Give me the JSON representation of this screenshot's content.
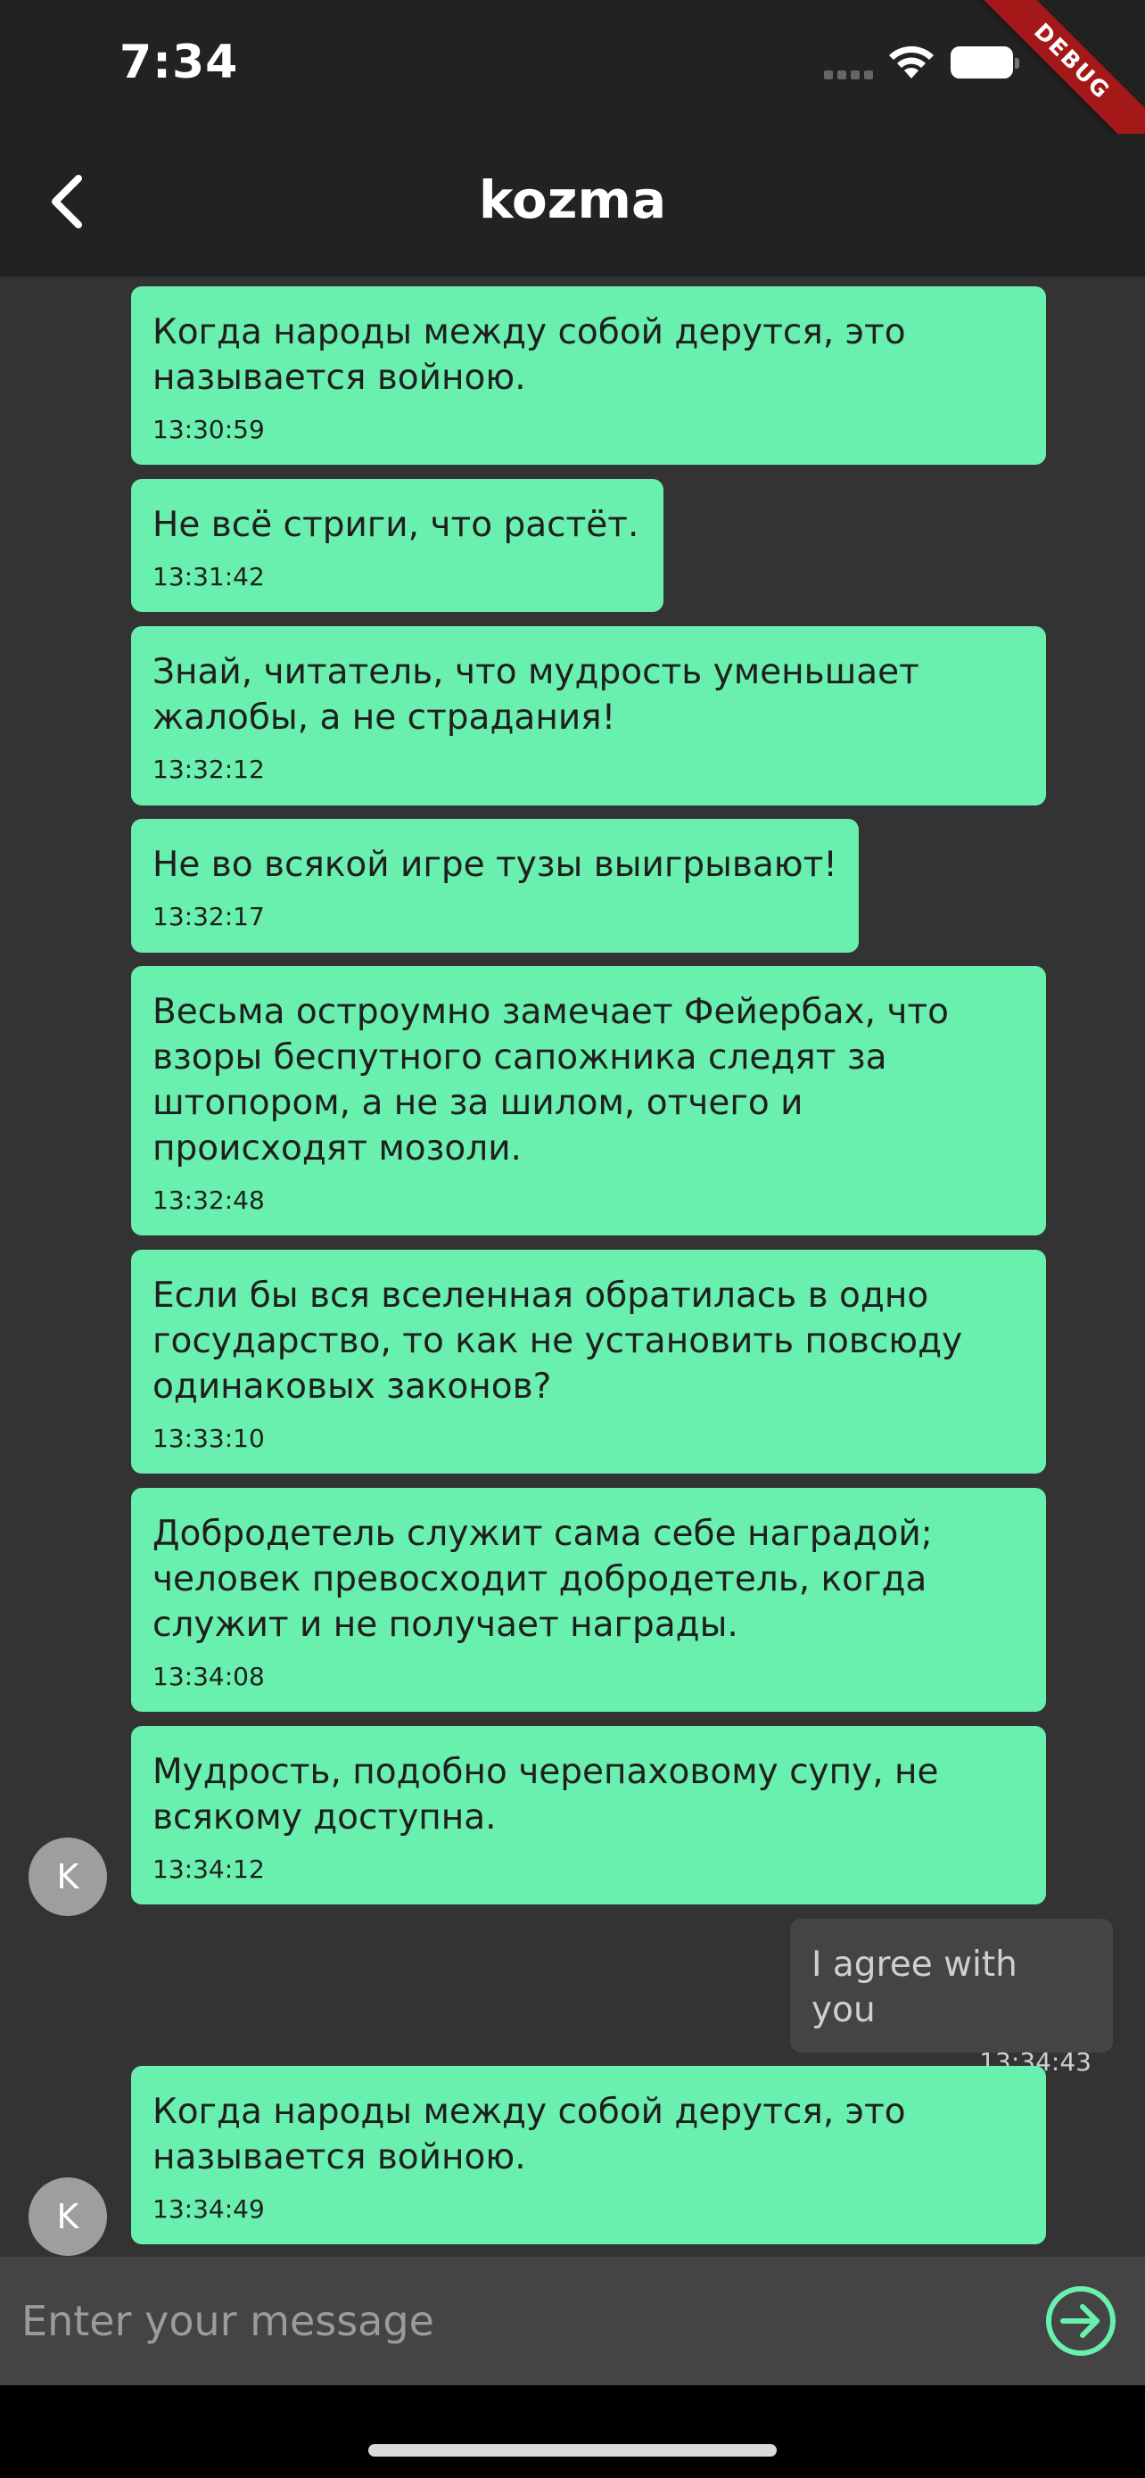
{
  "status_bar": {
    "time": "7:34",
    "debug_label": "DEBUG"
  },
  "app_bar": {
    "title": "kozma",
    "back_icon": "chevron-left-icon"
  },
  "messages": [
    {
      "direction": "in",
      "text": "Когда народы между собой дерутся, это\nназывается войною.",
      "time": "13:30:59"
    },
    {
      "direction": "in",
      "text": "Не всё стриги, что растёт.",
      "time": "13:31:42"
    },
    {
      "direction": "in",
      "text": "Знай, читатель, что мудрость уменьшает\nжалобы, а не страдания!",
      "time": "13:32:12"
    },
    {
      "direction": "in",
      "text": "Не во всякой игре тузы выигрывают!",
      "time": "13:32:17"
    },
    {
      "direction": "in",
      "text": "Весьма остроумно замечает Фейербах, что\nвзоры беспутного сапожника следят за\nштопором, а не за шилом, отчего и\nпроисходят мозоли.",
      "time": "13:32:48"
    },
    {
      "direction": "in",
      "text": "Если бы вся вселенная обратилась в одно\nгосударство, то как не установить повсюду\nодинаковых законов?",
      "time": "13:33:10"
    },
    {
      "direction": "in",
      "text": "Добродетель служит сама себе наградой;\nчеловек превосходит добродетель, когда\nслужит и не получает награды.",
      "time": "13:34:08"
    },
    {
      "direction": "in",
      "text": "Мудрость, подобно черепаховому супу, не\nвсякому доступна.",
      "time": "13:34:12",
      "avatar": "K"
    },
    {
      "direction": "out",
      "text": "I agree with you",
      "time": "13:34:43"
    },
    {
      "direction": "in",
      "text": "Когда народы между собой дерутся, это\nназывается войною.",
      "time": "13:34:49",
      "avatar": "K"
    }
  ],
  "composer": {
    "placeholder": "Enter your message",
    "value": "",
    "send_icon": "arrow-right-circle-icon"
  },
  "colors": {
    "incoming_bubble": "#69f0ae",
    "outgoing_bubble": "#444444",
    "background": "#333333",
    "bar": "#222222"
  }
}
